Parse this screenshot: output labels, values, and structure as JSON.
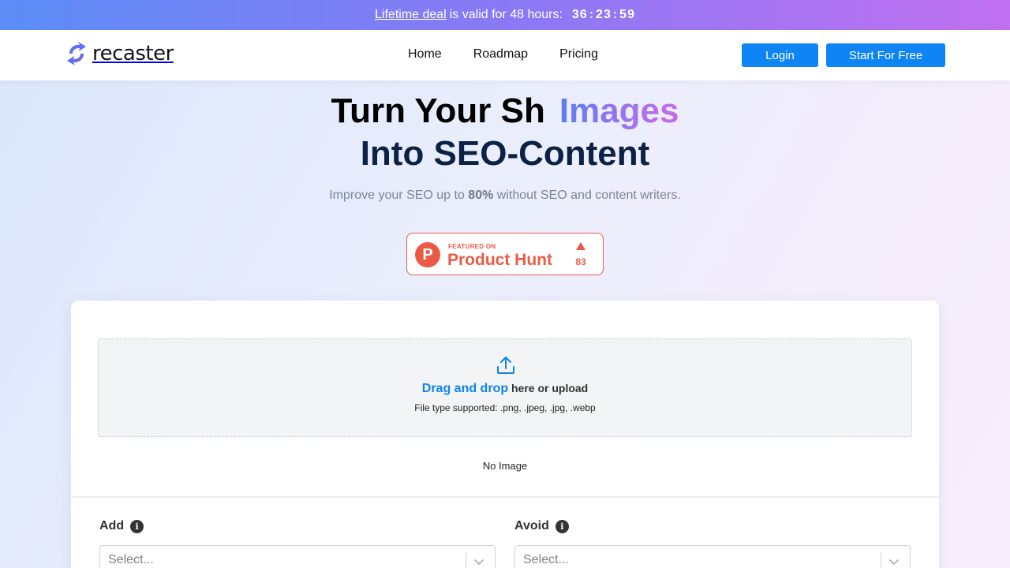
{
  "promo": {
    "link_text": "Lifetime deal",
    "text": "is valid for 48 hours:",
    "countdown": {
      "hours": "36",
      "minutes": "23",
      "seconds": "59",
      "separator": ":"
    }
  },
  "header": {
    "logo_text": "recaster",
    "nav": [
      "Home",
      "Roadmap",
      "Pricing"
    ],
    "login_label": "Login",
    "start_label": "Start For Free"
  },
  "hero": {
    "title_typed": "Turn Your Sh",
    "title_accent": "Images",
    "title_line2": "Into SEO-Content",
    "subtitle_before": "Improve your SEO up to",
    "subtitle_bold": "80%",
    "subtitle_after": "without SEO and content writers."
  },
  "product_hunt": {
    "logo_letter": "P",
    "small_text": "FEATURED ON",
    "name": "Product Hunt",
    "upvotes": "83",
    "color": "#ea5a47"
  },
  "uploader": {
    "icon": "upload-icon",
    "link_text": "Drag and drop",
    "text": "here or upload",
    "file_types": "File type supported: .png, .jpeg, .jpg, .webp",
    "empty_text": "No Image"
  },
  "fields": {
    "add": {
      "label": "Add",
      "placeholder": "Select..."
    },
    "avoid": {
      "label": "Avoid",
      "placeholder": "Select..."
    },
    "info_glyph": "i"
  },
  "colors": {
    "primary": "#0f84f5",
    "heading": "#0c2145",
    "accent_gradient": [
      "#5b7ff0",
      "#c56ceb"
    ]
  }
}
